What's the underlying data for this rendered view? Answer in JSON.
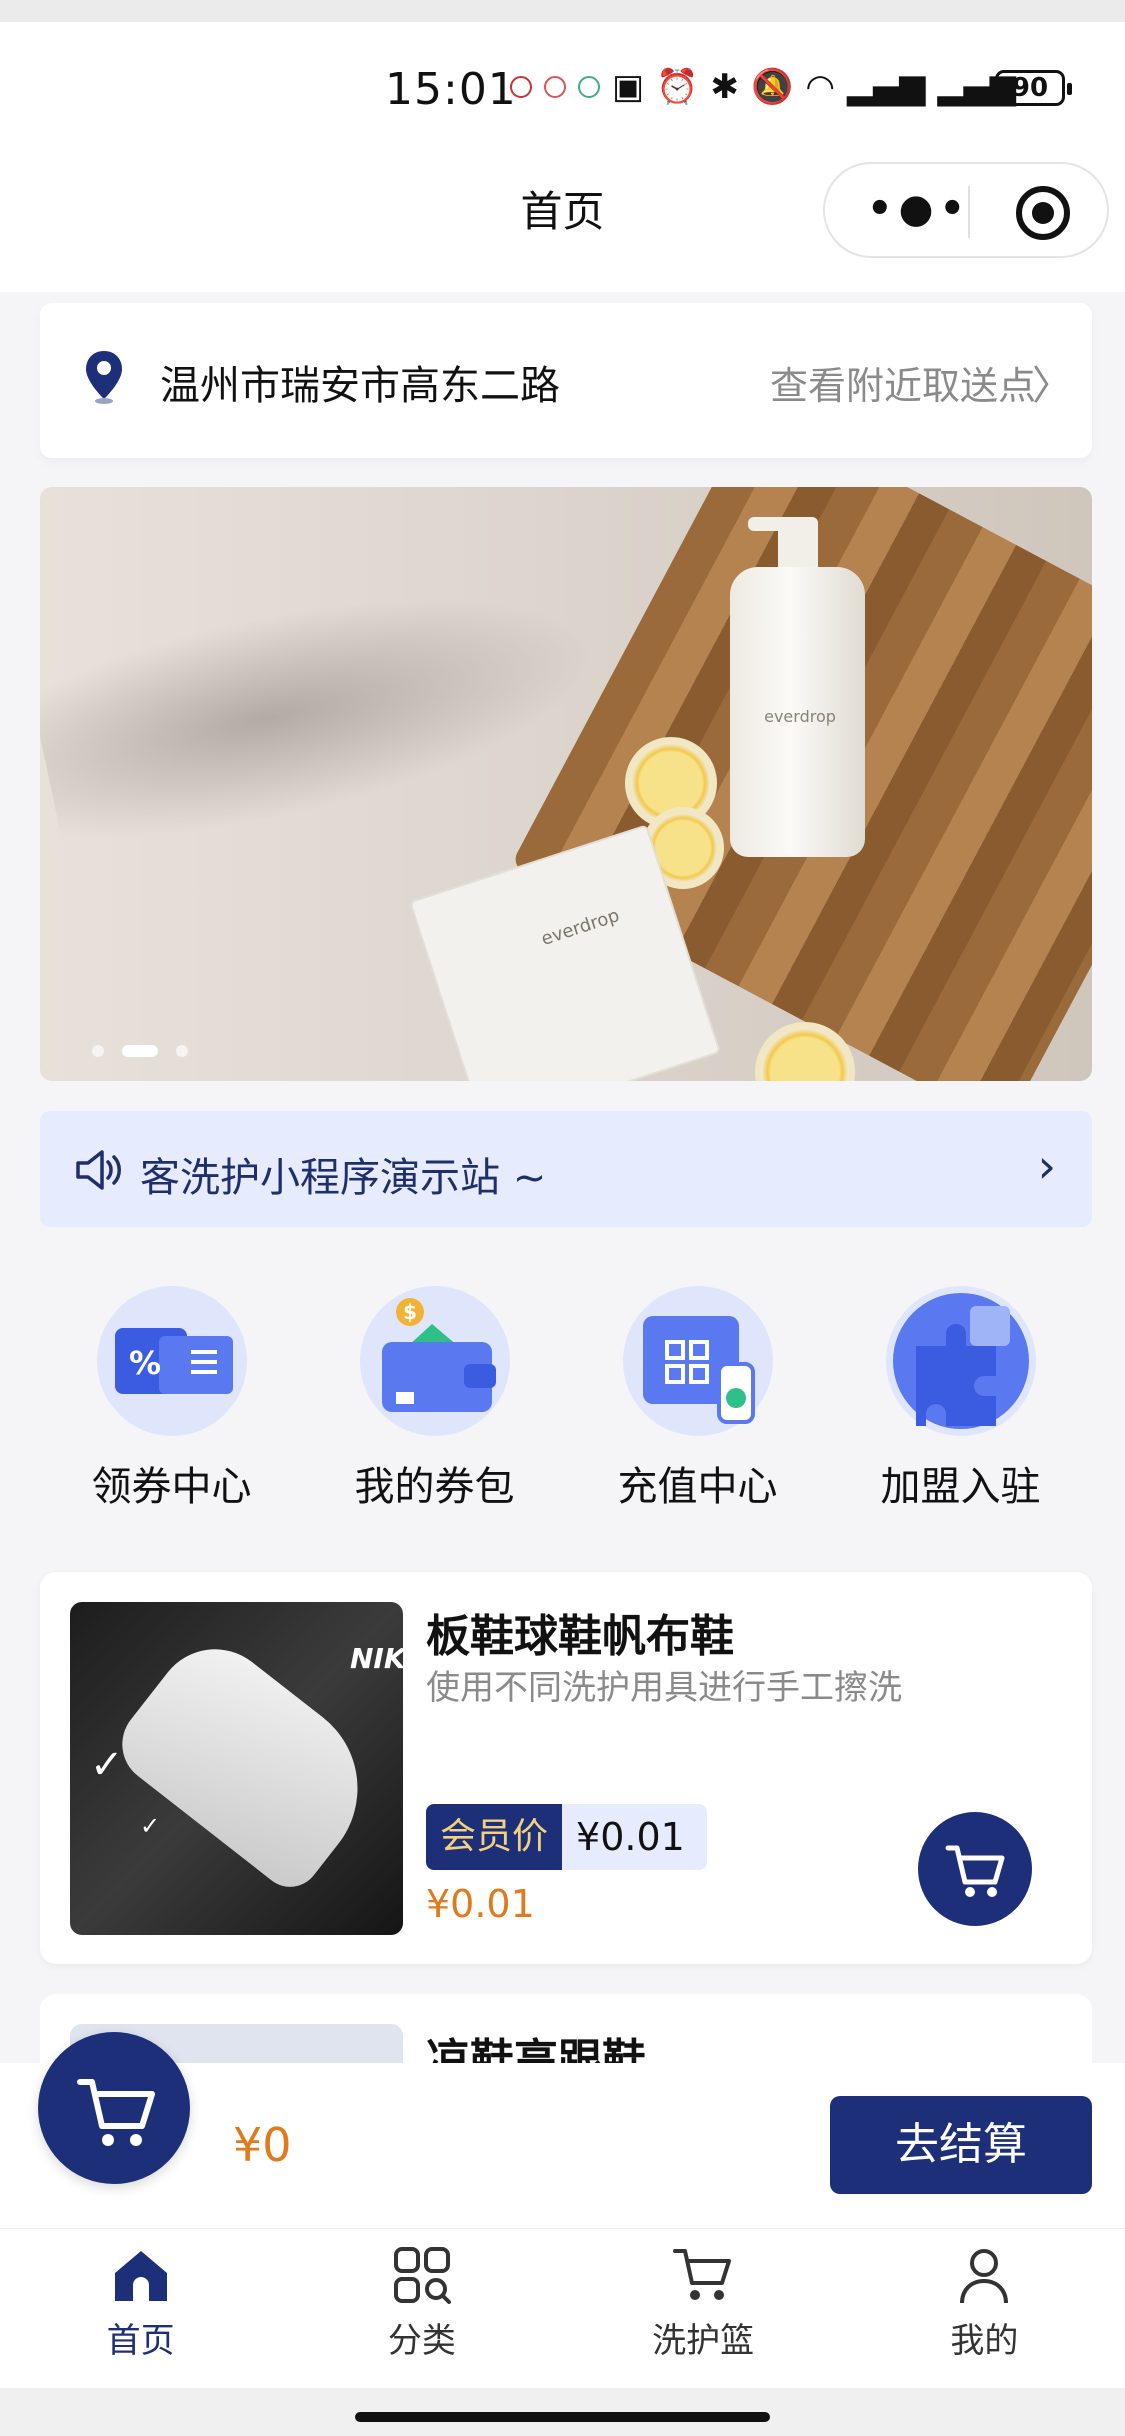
{
  "status_bar": {
    "time": "15:01",
    "battery": "90"
  },
  "nav": {
    "title": "首页"
  },
  "location": {
    "address": "温州市瑞安市高东二路",
    "link": "查看附近取送点"
  },
  "banner": {
    "bottle_brand": "everdrop",
    "packet_brand": "everdrop",
    "slides": 3,
    "active_slide": 2
  },
  "notice": {
    "text": "客洗护小程序演示站 ~"
  },
  "grid": {
    "items": [
      {
        "label": "领券中心",
        "icon": "coupon-icon"
      },
      {
        "label": "我的券包",
        "icon": "wallet-icon"
      },
      {
        "label": "充值中心",
        "icon": "recharge-icon"
      },
      {
        "label": "加盟入驻",
        "icon": "puzzle-icon"
      }
    ]
  },
  "products": [
    {
      "title": "板鞋球鞋帆布鞋",
      "subtitle": "使用不同洗护用具进行手工擦洗",
      "member_tag": "会员价",
      "member_price": "¥0.01",
      "price": "¥0.01",
      "brand": "NIKE"
    },
    {
      "title": "凉鞋高跟鞋"
    }
  ],
  "checkout": {
    "total": "¥0",
    "button": "去结算"
  },
  "tabbar": {
    "items": [
      {
        "label": "首页",
        "icon": "home-icon",
        "active": true
      },
      {
        "label": "分类",
        "icon": "category-icon"
      },
      {
        "label": "洗护篮",
        "icon": "cart-icon"
      },
      {
        "label": "我的",
        "icon": "profile-icon"
      }
    ]
  },
  "colors": {
    "primary": "#1e2f7a",
    "price": "#e07a1c",
    "notice_bg": "#e6ecfd"
  }
}
